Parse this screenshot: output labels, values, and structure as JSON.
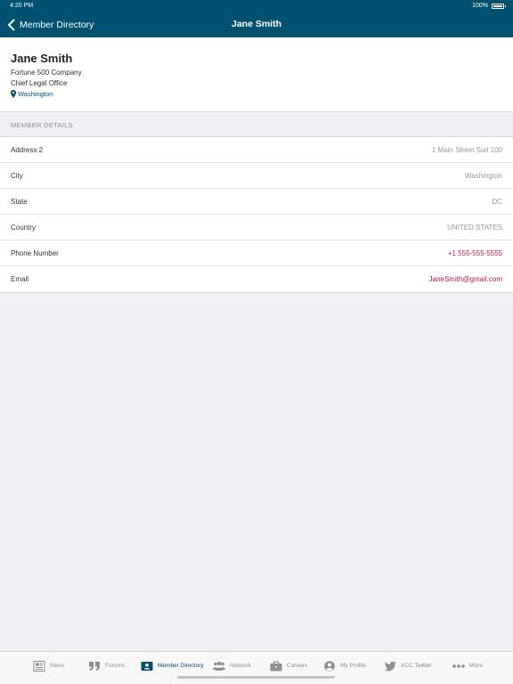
{
  "status_bar": {
    "time": "4:20 PM",
    "battery_text": "100%"
  },
  "nav": {
    "back_label": "Member Directory",
    "title": "Jane Smith"
  },
  "profile": {
    "name": "Jane Smith",
    "company": "Fortune 500 Company",
    "title": "Chief Legal Office",
    "location": "Washington"
  },
  "section": {
    "header": "MEMBER DETAILS"
  },
  "details": [
    {
      "label": "Address 2",
      "value": "1 Main Street Suit 100"
    },
    {
      "label": "City",
      "value": "Washington"
    },
    {
      "label": "State",
      "value": "DC"
    },
    {
      "label": "Country",
      "value": "UNITED STATES"
    },
    {
      "label": "Phone Number",
      "value": "+1 555-555-5555"
    },
    {
      "label": "Email",
      "value": "JaneSmith@gmail.com"
    }
  ],
  "tabs": [
    {
      "label": "News",
      "icon": "news-icon"
    },
    {
      "label": "Forums",
      "icon": "quote-icon"
    },
    {
      "label": "Member Directory",
      "icon": "member-card-icon",
      "active": true
    },
    {
      "label": "Network",
      "icon": "group-icon"
    },
    {
      "label": "Careers",
      "icon": "briefcase-icon"
    },
    {
      "label": "My Profile",
      "icon": "user-circle-icon"
    },
    {
      "label": "ACC Twitter",
      "icon": "twitter-bird-icon"
    },
    {
      "label": "More",
      "icon": "ellipsis-icon"
    }
  ],
  "colors": {
    "nav_background": "#00506f",
    "link_accent": "#b41a4a",
    "active_tab": "#00506f",
    "inactive_tab": "#8e8e93"
  }
}
